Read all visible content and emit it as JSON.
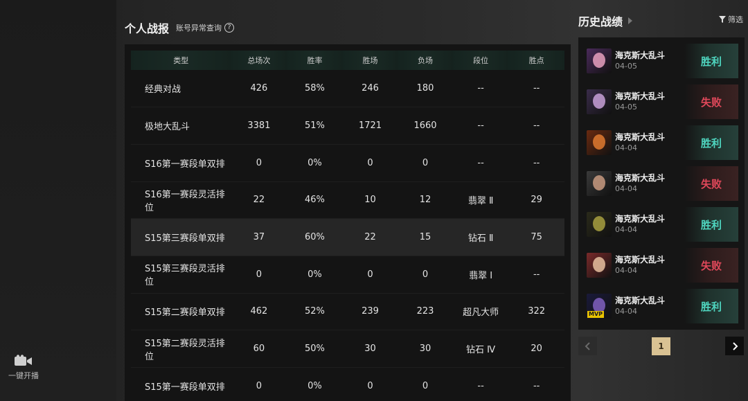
{
  "left_rail": {
    "stream_label": "一键开播"
  },
  "stats": {
    "title": "个人战报",
    "account_query": "账号异常查询",
    "help": "?",
    "headers": [
      "类型",
      "总场次",
      "胜率",
      "胜场",
      "负场",
      "段位",
      "胜点"
    ],
    "rows": [
      [
        "经典对战",
        "426",
        "58%",
        "246",
        "180",
        "--",
        "--"
      ],
      [
        "极地大乱斗",
        "3381",
        "51%",
        "1721",
        "1660",
        "--",
        "--"
      ],
      [
        "S16第一赛段单双排",
        "0",
        "0%",
        "0",
        "0",
        "--",
        "--"
      ],
      [
        "S16第一赛段灵活排位",
        "22",
        "46%",
        "10",
        "12",
        "翡翠 Ⅱ",
        "29"
      ],
      [
        "S15第三赛段单双排",
        "37",
        "60%",
        "22",
        "15",
        "钻石 Ⅱ",
        "75"
      ],
      [
        "S15第三赛段灵活排位",
        "0",
        "0%",
        "0",
        "0",
        "翡翠 Ⅰ",
        "--"
      ],
      [
        "S15第二赛段单双排",
        "462",
        "52%",
        "239",
        "223",
        "超凡大师",
        "322"
      ],
      [
        "S15第二赛段灵活排位",
        "60",
        "50%",
        "30",
        "30",
        "钻石 Ⅳ",
        "20"
      ],
      [
        "S15第一赛段单双排",
        "0",
        "0%",
        "0",
        "0",
        "--",
        "--"
      ]
    ],
    "highlighted_row": 4
  },
  "history": {
    "title": "历史战绩",
    "filter_label": "筛选",
    "matches": [
      {
        "mode": "海克斯大乱斗",
        "date": "04-05",
        "result": "胜利",
        "outcome": "win",
        "avatar_colors": [
          "#4a2a5a",
          "#e8a0c0"
        ]
      },
      {
        "mode": "海克斯大乱斗",
        "date": "04-05",
        "result": "失败",
        "outcome": "loss",
        "avatar_colors": [
          "#3a2c4a",
          "#c8a0d8"
        ]
      },
      {
        "mode": "海克斯大乱斗",
        "date": "04-04",
        "result": "胜利",
        "outcome": "win",
        "avatar_colors": [
          "#6a2a10",
          "#e07a30"
        ]
      },
      {
        "mode": "海克斯大乱斗",
        "date": "04-04",
        "result": "失败",
        "outcome": "loss",
        "avatar_colors": [
          "#3a3a3a",
          "#c89a80"
        ]
      },
      {
        "mode": "海克斯大乱斗",
        "date": "04-04",
        "result": "胜利",
        "outcome": "win",
        "avatar_colors": [
          "#2a2a1a",
          "#a8a040"
        ]
      },
      {
        "mode": "海克斯大乱斗",
        "date": "04-04",
        "result": "失败",
        "outcome": "loss",
        "avatar_colors": [
          "#7a2a2a",
          "#e8c0a0"
        ]
      },
      {
        "mode": "海克斯大乱斗",
        "date": "04-04",
        "result": "胜利",
        "outcome": "win",
        "avatar_colors": [
          "#1a1a3a",
          "#8060c0"
        ],
        "mvp": "MVP"
      }
    ],
    "pager": {
      "current_page": "1"
    }
  },
  "colors": {
    "win": "#4fd6c0",
    "loss": "#e0485a",
    "page_active": "#d9c293"
  }
}
